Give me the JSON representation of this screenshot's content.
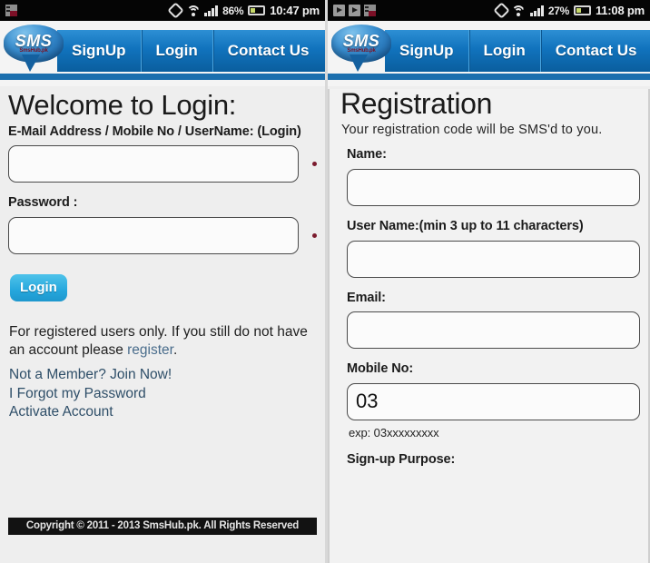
{
  "left": {
    "statusbar": {
      "notifications": [
        "message-icon"
      ],
      "rotation_icon": "rotation-lock-icon",
      "wifi_icon": "wifi-icon",
      "signal_icon": "signal-bars-icon",
      "battery_percent": "86%",
      "battery_icon": "battery-icon",
      "time": "10:47 pm"
    },
    "logo": {
      "text": "SMS",
      "subtext": "SmsHub.pk"
    },
    "nav": [
      {
        "label": "SignUp"
      },
      {
        "label": "Login"
      },
      {
        "label": "Contact Us"
      }
    ],
    "title": "Welcome to Login:",
    "fields": [
      {
        "label": "E-Mail Address / Mobile No / UserName: (Login)",
        "value": "",
        "placeholder": "",
        "required_marker": true
      },
      {
        "label": "Password :",
        "value": "",
        "placeholder": "",
        "required_marker": true
      }
    ],
    "submit_label": "Login",
    "note_prefix": "For registered users only. If you still do not have an account please ",
    "note_link": "register",
    "note_suffix": ".",
    "links": [
      "Not a Member? Join Now!",
      "I Forgot my Password",
      "Activate Account"
    ],
    "copyright": "Copyright © 2011 - 2013 SmsHub.pk. All Rights Reserved"
  },
  "right": {
    "statusbar": {
      "notifications": [
        "play-store-icon",
        "play-store-icon",
        "message-icon"
      ],
      "rotation_icon": "rotation-lock-icon",
      "wifi_icon": "wifi-icon",
      "signal_icon": "signal-bars-icon",
      "battery_percent": "27%",
      "battery_icon": "battery-icon",
      "time": "11:08 pm"
    },
    "logo": {
      "text": "SMS",
      "subtext": "SmsHub.pk"
    },
    "nav": [
      {
        "label": "SignUp"
      },
      {
        "label": "Login"
      },
      {
        "label": "Contact Us"
      }
    ],
    "title": "Registration",
    "lead": "Your registration code will be SMS'd to you.",
    "fields": [
      {
        "label": "Name:",
        "value": "",
        "hint": ""
      },
      {
        "label": "User Name:(min 3 up to 11 characters)",
        "value": "",
        "hint": ""
      },
      {
        "label": "Email:",
        "value": "",
        "hint": ""
      },
      {
        "label": "Mobile No:",
        "value": "03",
        "hint": "exp: 03xxxxxxxxx"
      }
    ],
    "next_label": "Sign-up Purpose:"
  },
  "colors": {
    "nav_blue": "#1173bd",
    "button_cyan": "#25a7dd",
    "link_slate": "#2e4e68",
    "required_dot": "#7b1b2e",
    "page_bg": "#eeeeee",
    "statusbar_bg": "#050505"
  }
}
